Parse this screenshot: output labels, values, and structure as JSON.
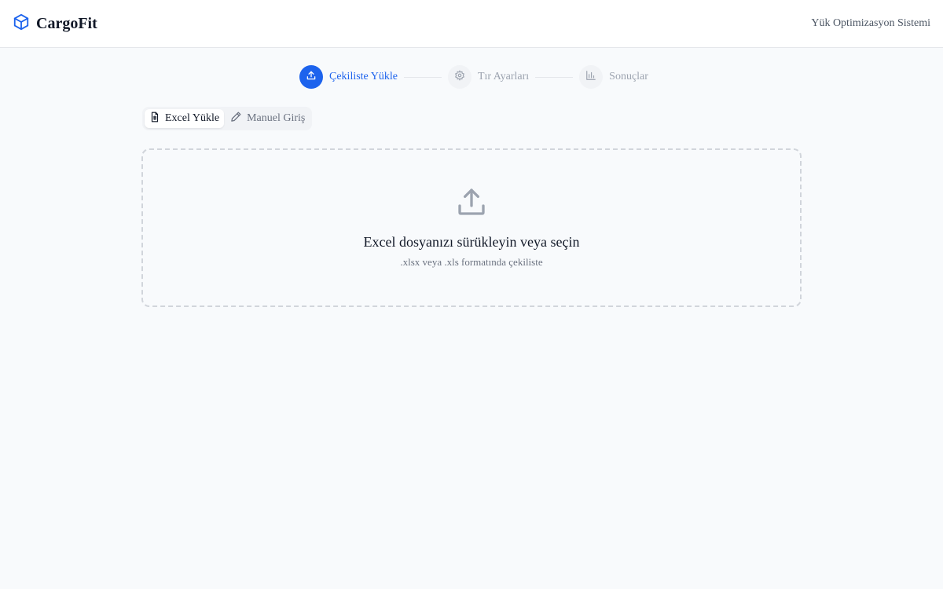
{
  "header": {
    "brand": "CargoFit",
    "subtitle": "Yük Optimizasyon Sistemi",
    "brand_color": "#1d63ed"
  },
  "stepper": {
    "steps": [
      {
        "label": "Çekiliste Yükle",
        "icon": "upload-icon",
        "state": "active"
      },
      {
        "label": "Tır Ayarları",
        "icon": "gear-icon",
        "state": "inactive"
      },
      {
        "label": "Sonuçlar",
        "icon": "bar-chart-icon",
        "state": "inactive"
      }
    ]
  },
  "tabs": [
    {
      "label": "Excel Yükle",
      "icon": "spreadsheet-file-icon",
      "selected": true
    },
    {
      "label": "Manuel Giriş",
      "icon": "pencil-icon",
      "selected": false
    }
  ],
  "dropzone": {
    "icon": "upload-icon",
    "title": "Excel dosyanızı sürükleyin veya seçin",
    "subtitle": ".xlsx veya .xls formatında çekiliste"
  }
}
